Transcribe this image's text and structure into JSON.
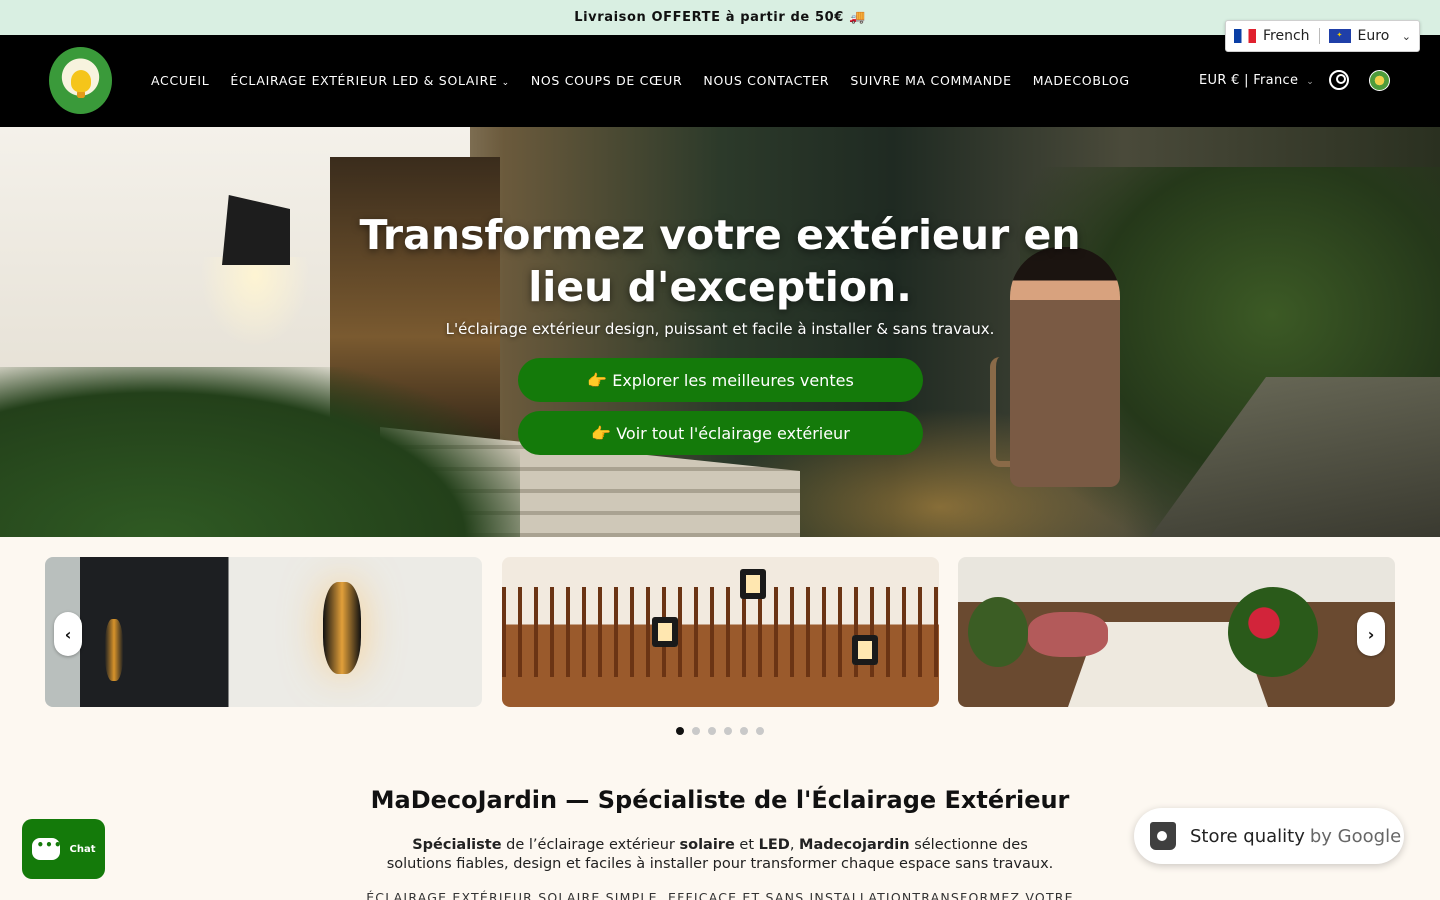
{
  "announcement": "Livraison OFFERTE à partir de 50€ 🚚",
  "language_picker": {
    "language": "French",
    "currency": "Euro"
  },
  "nav": {
    "items": [
      {
        "label": "ACCUEIL"
      },
      {
        "label": "ÉCLAIRAGE EXTÉRIEUR LED & SOLAIRE",
        "has_dropdown": true
      },
      {
        "label": "NOS COUPS DE CŒUR"
      },
      {
        "label": "NOUS CONTACTER"
      },
      {
        "label": "SUIVRE MA COMMANDE"
      },
      {
        "label": "MADECOBLOG"
      }
    ],
    "region": "EUR € | France"
  },
  "hero": {
    "title": "Transformez votre extérieur en lieu d'exception.",
    "subtitle": "L'éclairage extérieur design, puissant et facile à installer & sans travaux.",
    "button_1": "👉 Explorer les meilleures ventes",
    "button_2": "👉 Voir tout l'éclairage extérieur"
  },
  "carousel": {
    "dot_count": 6,
    "active_index": 0,
    "slide_count": 3
  },
  "section": {
    "title": "MaDecoJardin — Spécialiste de l'Éclairage Extérieur",
    "body_parts": [
      "Spécialiste",
      " de l’éclairage extérieur ",
      "solaire",
      " et ",
      "LED",
      ", ",
      "Madecojardin",
      " sélectionne des solutions fiables, design et faciles à installer pour transformer chaque espace sans travaux."
    ],
    "cut_text": "ÉCLAIRAGE EXTÉRIEUR SOLAIRE SIMPLE, EFFICACE ET SANS INSTALLATIONTRANSFORMEZ VOTRE"
  },
  "chat": {
    "label": "Chat"
  },
  "google_badge": {
    "text": "Store quality",
    "by": "by Google"
  },
  "colors": {
    "accent_green": "#147a0a",
    "announcement_bg": "#d9efe2",
    "header_bg": "#000000",
    "page_bg": "#fdf8f1"
  }
}
